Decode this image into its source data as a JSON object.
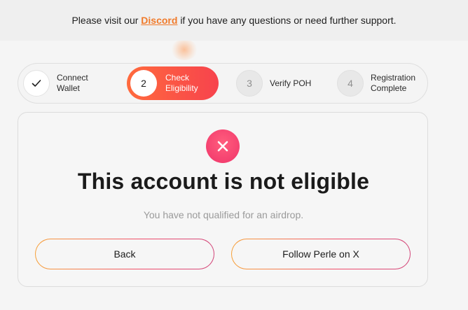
{
  "banner": {
    "prefix": "Please visit our",
    "link": "Discord",
    "suffix": "if you have any questions or need further support."
  },
  "stepper": {
    "steps": [
      {
        "number": "",
        "label_line1": "Connect",
        "label_line2": "Wallet",
        "state": "done"
      },
      {
        "number": "2",
        "label_line1": "Check",
        "label_line2": "Eligibility",
        "state": "active"
      },
      {
        "number": "3",
        "label_line1": "Verify POH",
        "label_line2": "",
        "state": "todo"
      },
      {
        "number": "4",
        "label_line1": "Registration",
        "label_line2": "Complete",
        "state": "todo"
      }
    ]
  },
  "result": {
    "icon": "x-icon",
    "title": "This account is not eligible",
    "message": "You have not qualified for an airdrop."
  },
  "actions": {
    "back_label": "Back",
    "follow_label": "Follow Perle on X"
  },
  "colors": {
    "accent_orange": "#f07a2a",
    "active_step_start": "#ff6a3d",
    "active_step_end": "#f7434d",
    "error_pink": "#f0356a"
  }
}
